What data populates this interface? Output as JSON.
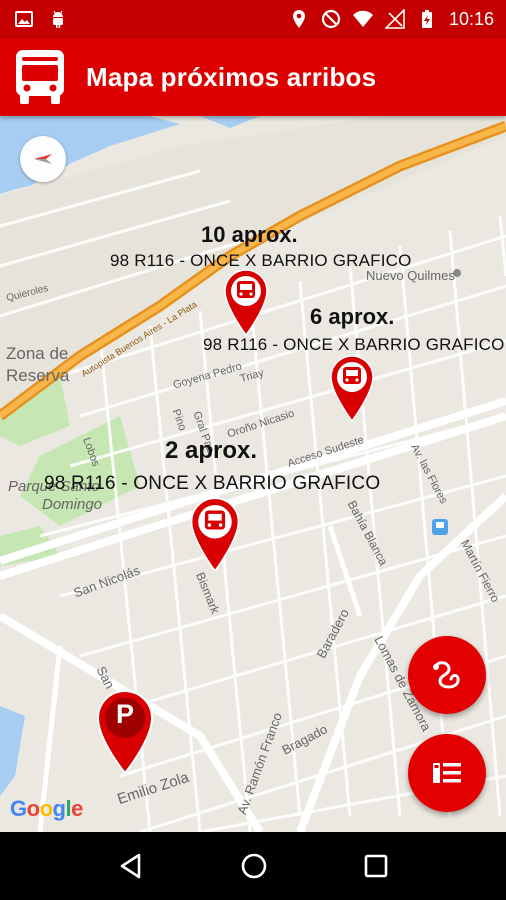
{
  "status_bar": {
    "time": "10:16",
    "left_icons": [
      "image-icon",
      "android-icon"
    ],
    "right_icons": [
      "location-icon",
      "do-not-disturb-icon",
      "wifi-icon",
      "signal-icon",
      "battery-icon"
    ]
  },
  "app_bar": {
    "title": "Mapa próximos arribos",
    "icon": "bus-icon",
    "color": "#dd0000"
  },
  "map": {
    "labels": {
      "nuevo_quilmes": "Nuevo Quilmes",
      "zona_de": "Zona de",
      "reserva": "Reserva",
      "parque": "Parque Santo",
      "domingo": "Domingo",
      "quieroles": "Quieroles",
      "goyena": "Goyena Pedro",
      "triay": "Triay",
      "pino": "Pino",
      "gral_paz": "Gral Paz",
      "orono": "Oroño Nicasio",
      "lobos": "Lobos",
      "acceso_sudeste": "Acceso Sudeste",
      "av_las_flores": "Av. las Flores",
      "bahia_blanca": "Bahía Blanca",
      "martin_fierro": "Martín Fierro",
      "san_nicolas": "San Nicolás",
      "bismark": "Bismark",
      "baradero": "Baradero",
      "lomas_de_zamora": "Lomas de Zamora",
      "bragado": "Bragado",
      "av_ramon_franco": "Av. Ramón Franco",
      "emilio_zola": "Emilio Zola",
      "san": "San",
      "highway": "Autopista Buenos Aires - La Plata"
    },
    "arrivals": [
      {
        "count": "10 aprox.",
        "route": "98 R116 - ONCE X BARRIO GRAFICO"
      },
      {
        "count": "6 aprox.",
        "route": "98 R116 - ONCE X BARRIO GRAFICO"
      },
      {
        "count": "2 aprox.",
        "route": "98 R116 - ONCE X BARRIO GRAFICO"
      }
    ],
    "parking_marker": "P",
    "attribution": [
      "G",
      "o",
      "o",
      "g",
      "l",
      "e"
    ],
    "compass_icon": "compass-icon"
  },
  "fabs": {
    "route_icon": "route-icon",
    "list_icon": "list-icon"
  },
  "nav_bar": {
    "icons": [
      "back-icon",
      "home-icon",
      "recents-icon"
    ]
  },
  "colors": {
    "primary": "#dd0000",
    "status": "#c40000",
    "fab": "#e30000",
    "highway": "#f5a21f",
    "water": "#a8cdf2",
    "park": "#c6e6b3"
  }
}
